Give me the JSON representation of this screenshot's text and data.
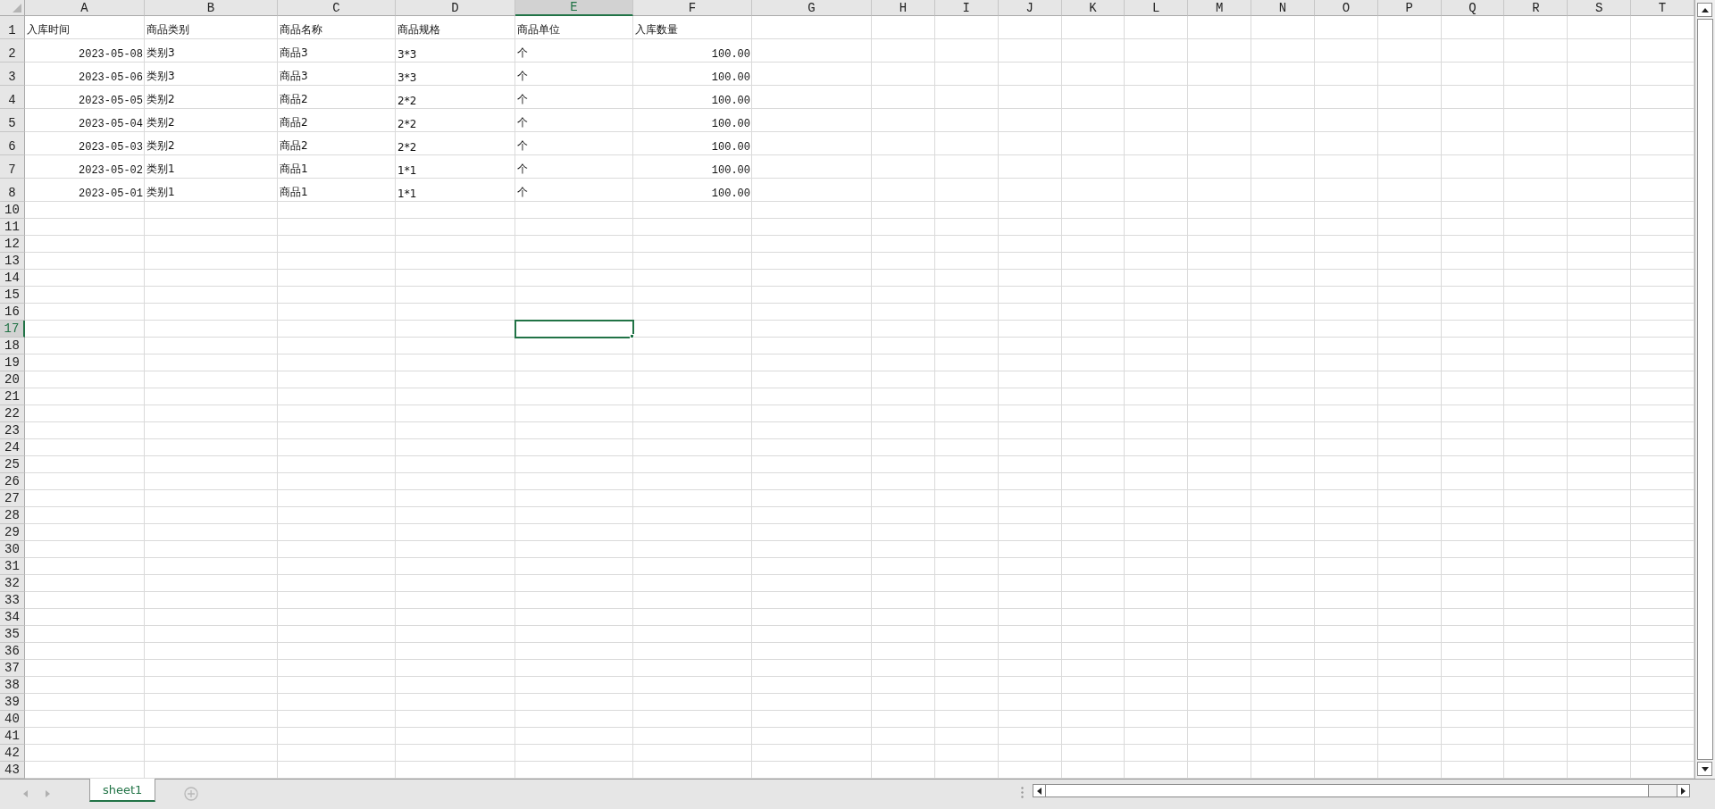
{
  "columns": [
    {
      "label": "A",
      "selected": false
    },
    {
      "label": "B",
      "selected": false
    },
    {
      "label": "C",
      "selected": false
    },
    {
      "label": "D",
      "selected": false
    },
    {
      "label": "E",
      "selected": true
    },
    {
      "label": "F",
      "selected": false
    },
    {
      "label": "G",
      "selected": false
    },
    {
      "label": "H",
      "selected": false
    },
    {
      "label": "I",
      "selected": false
    },
    {
      "label": "J",
      "selected": false
    },
    {
      "label": "K",
      "selected": false
    },
    {
      "label": "L",
      "selected": false
    },
    {
      "label": "M",
      "selected": false
    },
    {
      "label": "N",
      "selected": false
    },
    {
      "label": "O",
      "selected": false
    },
    {
      "label": "P",
      "selected": false
    },
    {
      "label": "Q",
      "selected": false
    },
    {
      "label": "R",
      "selected": false
    },
    {
      "label": "S",
      "selected": false
    },
    {
      "label": "T",
      "selected": false
    }
  ],
  "rows": [
    {
      "number": "1",
      "selected": false,
      "cells": [
        {
          "text": "入库时间",
          "kind": "text"
        },
        {
          "text": "商品类别",
          "kind": "text"
        },
        {
          "text": "商品名称",
          "kind": "text"
        },
        {
          "text": "商品规格",
          "kind": "text"
        },
        {
          "text": "商品单位",
          "kind": "text"
        },
        {
          "text": "入库数量",
          "kind": "text"
        }
      ]
    },
    {
      "number": "2",
      "selected": false,
      "cells": [
        {
          "text": "2023-05-08",
          "kind": "number"
        },
        {
          "text": "类别3",
          "kind": "text"
        },
        {
          "text": "商品3",
          "kind": "text"
        },
        {
          "text": "3*3",
          "kind": "text"
        },
        {
          "text": "个",
          "kind": "text"
        },
        {
          "text": "100.00",
          "kind": "number"
        }
      ]
    },
    {
      "number": "3",
      "selected": false,
      "cells": [
        {
          "text": "2023-05-06",
          "kind": "number"
        },
        {
          "text": "类别3",
          "kind": "text"
        },
        {
          "text": "商品3",
          "kind": "text"
        },
        {
          "text": "3*3",
          "kind": "text"
        },
        {
          "text": "个",
          "kind": "text"
        },
        {
          "text": "100.00",
          "kind": "number"
        }
      ]
    },
    {
      "number": "4",
      "selected": false,
      "cells": [
        {
          "text": "2023-05-05",
          "kind": "number"
        },
        {
          "text": "类别2",
          "kind": "text"
        },
        {
          "text": "商品2",
          "kind": "text"
        },
        {
          "text": "2*2",
          "kind": "text"
        },
        {
          "text": "个",
          "kind": "text"
        },
        {
          "text": "100.00",
          "kind": "number"
        }
      ]
    },
    {
      "number": "5",
      "selected": false,
      "cells": [
        {
          "text": "2023-05-04",
          "kind": "number"
        },
        {
          "text": "类别2",
          "kind": "text"
        },
        {
          "text": "商品2",
          "kind": "text"
        },
        {
          "text": "2*2",
          "kind": "text"
        },
        {
          "text": "个",
          "kind": "text"
        },
        {
          "text": "100.00",
          "kind": "number"
        }
      ]
    },
    {
      "number": "6",
      "selected": false,
      "cells": [
        {
          "text": "2023-05-03",
          "kind": "number"
        },
        {
          "text": "类别2",
          "kind": "text"
        },
        {
          "text": "商品2",
          "kind": "text"
        },
        {
          "text": "2*2",
          "kind": "text"
        },
        {
          "text": "个",
          "kind": "text"
        },
        {
          "text": "100.00",
          "kind": "number"
        }
      ]
    },
    {
      "number": "7",
      "selected": false,
      "cells": [
        {
          "text": "2023-05-02",
          "kind": "number"
        },
        {
          "text": "类别1",
          "kind": "text"
        },
        {
          "text": "商品1",
          "kind": "text"
        },
        {
          "text": "1*1",
          "kind": "text"
        },
        {
          "text": "个",
          "kind": "text"
        },
        {
          "text": "100.00",
          "kind": "number"
        }
      ]
    },
    {
      "number": "8",
      "selected": false,
      "cells": [
        {
          "text": "2023-05-01",
          "kind": "number"
        },
        {
          "text": "类别1",
          "kind": "text"
        },
        {
          "text": "商品1",
          "kind": "text"
        },
        {
          "text": "1*1",
          "kind": "text"
        },
        {
          "text": "个",
          "kind": "text"
        },
        {
          "text": "100.00",
          "kind": "number"
        }
      ]
    },
    {
      "number": "10",
      "selected": false
    },
    {
      "number": "11",
      "selected": false
    },
    {
      "number": "12",
      "selected": false
    },
    {
      "number": "13",
      "selected": false
    },
    {
      "number": "14",
      "selected": false
    },
    {
      "number": "15",
      "selected": false
    },
    {
      "number": "16",
      "selected": false
    },
    {
      "number": "17",
      "selected": true
    },
    {
      "number": "18",
      "selected": false
    },
    {
      "number": "19",
      "selected": false
    },
    {
      "number": "20",
      "selected": false
    },
    {
      "number": "21",
      "selected": false
    },
    {
      "number": "22",
      "selected": false
    },
    {
      "number": "23",
      "selected": false
    },
    {
      "number": "24",
      "selected": false
    },
    {
      "number": "25",
      "selected": false
    },
    {
      "number": "26",
      "selected": false
    },
    {
      "number": "27",
      "selected": false
    },
    {
      "number": "28",
      "selected": false
    },
    {
      "number": "29",
      "selected": false
    },
    {
      "number": "30",
      "selected": false
    },
    {
      "number": "31",
      "selected": false
    },
    {
      "number": "32",
      "selected": false
    },
    {
      "number": "33",
      "selected": false
    },
    {
      "number": "34",
      "selected": false
    },
    {
      "number": "35",
      "selected": false
    },
    {
      "number": "36",
      "selected": false
    },
    {
      "number": "37",
      "selected": false
    },
    {
      "number": "38",
      "selected": false
    },
    {
      "number": "39",
      "selected": false
    },
    {
      "number": "40",
      "selected": false
    },
    {
      "number": "41",
      "selected": false
    },
    {
      "number": "42",
      "selected": false
    },
    {
      "number": "43",
      "selected": false
    }
  ],
  "sheet_tabs": [
    {
      "label": "sheet1",
      "selected": true
    }
  ]
}
